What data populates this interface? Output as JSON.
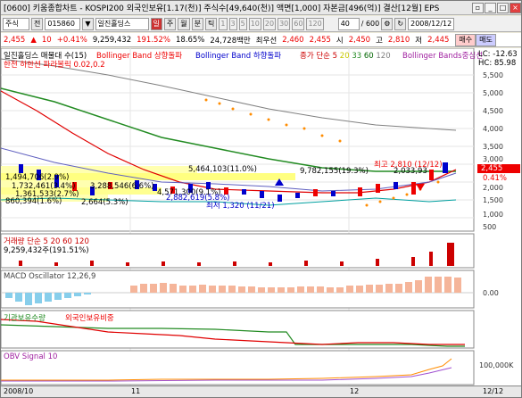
{
  "titlebar": {
    "title": "[0600] 키움종합차트 - KOSPI200 외국인보유[1.17(천)] 주식수[49,640(천)] 액면[1,000] 자본금[496(억)] 결산[12월] EPS",
    "date": "2008/12/12",
    "icons": [
      "icon1",
      "icon2",
      "close-icon"
    ]
  },
  "toolbar": {
    "market": "주식",
    "code_type": "전",
    "code": "015860",
    "stock_name": "일진홀딩스",
    "period_buttons": [
      "일",
      "주",
      "월",
      "분",
      "틱",
      "1",
      "3",
      "5",
      "10",
      "20",
      "30",
      "60",
      "120"
    ],
    "count_value": "40",
    "count_total": "/ 600"
  },
  "pricebar": {
    "price": "2,455",
    "change_symbol": "▲",
    "change": "10",
    "change_pct": "+0.41%",
    "volume": "9,259,432",
    "volume_pct": "191.52%",
    "turnover": "18.65%",
    "amount": "24,728백만",
    "best_offer_label": "최우선",
    "best_bid": "2,460",
    "best_ask": "2,455",
    "open_label": "시",
    "open": "2,450",
    "high_label": "고",
    "high": "2,810",
    "low_label": "저",
    "low": "2,445",
    "buy_label": "매수",
    "sell_label": "매도"
  },
  "legends": {
    "main_title": "일진홀딩스 매물대 수(15)",
    "main_sub": "한전 하한선 파라볼릭 0.02,0.2",
    "bb_upper": "Bollinger Band 상향돌파",
    "bb_lower": "Bollinger Band 하향돌파",
    "ma_label": "종가 단순 5",
    "ma_periods": [
      "20",
      "33",
      "60",
      "120"
    ],
    "bb_center": "Bollinger Bands중심선",
    "hc_label": "HC: 85.98",
    "lc_label": "LC: -12.63",
    "volume": "거래량 단순 5 20 60 120",
    "volume_value": "9,259,432주(191.51%)",
    "macd": "MACD Oscillator 12,26,9",
    "inst": "기관보유수량",
    "foreign": "외국인보유비중",
    "obv": "OBV Signal 10"
  },
  "annotations": {
    "high_note": "최고 2,810 (12/12)",
    "low_note": "최저 1,320 (11/21)",
    "vp1": "5,464,103(11.0%)",
    "vp2": "9,782,155(19.3%)",
    "vp3": "3,288,546(6.6%)",
    "vp4": "4,571,300(9.1%)",
    "vp5": "2,882,619(5.8%)",
    "vp6": "860,394(1.6%)",
    "vp7": "2,664(5.3%)",
    "vp8": "1,494,706(2.9%)",
    "vp9": "1,732,461(3.4%)",
    "vp10": "1,361,533(2.7%)",
    "vp11": "2,033,93",
    "price_tag": "2,455",
    "price_tag_pct": "0.41%"
  },
  "yaxis_main": [
    "5,500",
    "5,000",
    "4,500",
    "4,000",
    "3,500",
    "3,000",
    "2,500",
    "2,000",
    "1,500",
    "1,000",
    "500"
  ],
  "yaxis_macd": "0.00",
  "yaxis_obv": "100,000K",
  "xaxis": [
    "2008/10",
    "11",
    "12",
    "12/12"
  ],
  "colors": {
    "up": "#e00000",
    "down": "#0000cc",
    "ma5": "#ff8c00",
    "ma20": "#c8c800",
    "ma60": "#228b22",
    "ma120": "#808080",
    "macd_pos": "#f5b59a",
    "macd_neg": "#87ceeb"
  }
}
